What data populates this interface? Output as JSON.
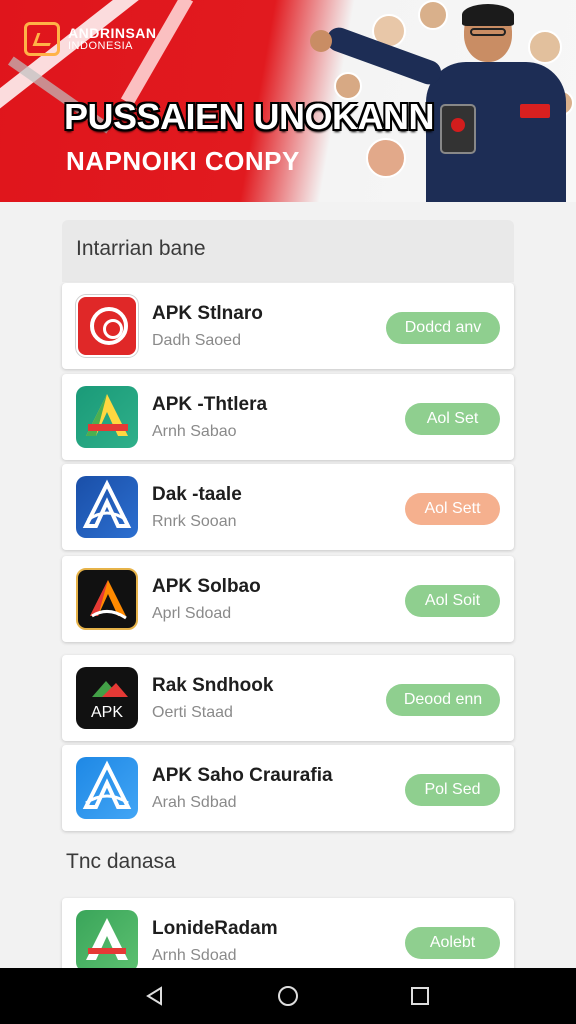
{
  "banner": {
    "brand_name": "ANDRINSAN",
    "brand_sub": "INDONESIA",
    "headline": "PUSSAIEN UNOKANN",
    "subheadline": "NAPNOIKI CONPY"
  },
  "section1": {
    "title": "Intarrian bane"
  },
  "apps": [
    {
      "name": "APK Stlnaro",
      "sub": "Dadh Saoed",
      "button": "Dodcd anv",
      "button_color": "#8fcf8f",
      "icon": "red-ring-icon"
    },
    {
      "name": "APK -Thtlera",
      "sub": "Arnh Sabao",
      "button": "Aol Set",
      "button_color": "#8fcf8f",
      "icon": "teal-a-icon"
    },
    {
      "name": "Dak -taale",
      "sub": "Rnrk Sooan",
      "button": "Aol Sett",
      "button_color": "#f5b08e",
      "icon": "navy-a-icon"
    },
    {
      "name": "APK Solbao",
      "sub": "Aprl Sdoad",
      "button": "Aol Soit",
      "button_color": "#8fcf8f",
      "icon": "black-apk-icon"
    },
    {
      "name": "Rak Sndhook",
      "sub": "Oerti Staad",
      "button": "Deood enn",
      "button_color": "#8fcf8f",
      "icon": "apk-logo-icon"
    },
    {
      "name": "APK Saho Craurafia",
      "sub": "Arah Sdbad",
      "button": "Pol Sed",
      "button_color": "#8fcf8f",
      "icon": "blue-a-icon"
    }
  ],
  "section2": {
    "title": "Tnc danasa"
  },
  "apps2": [
    {
      "name": "LonideRadam",
      "sub": "Arnh Sdoad",
      "button": "Aolebt",
      "button_color": "#8fcf8f",
      "icon": "green-a-icon"
    }
  ],
  "navbar": {
    "back": "back-icon",
    "home": "home-icon",
    "recent": "recents-icon"
  }
}
